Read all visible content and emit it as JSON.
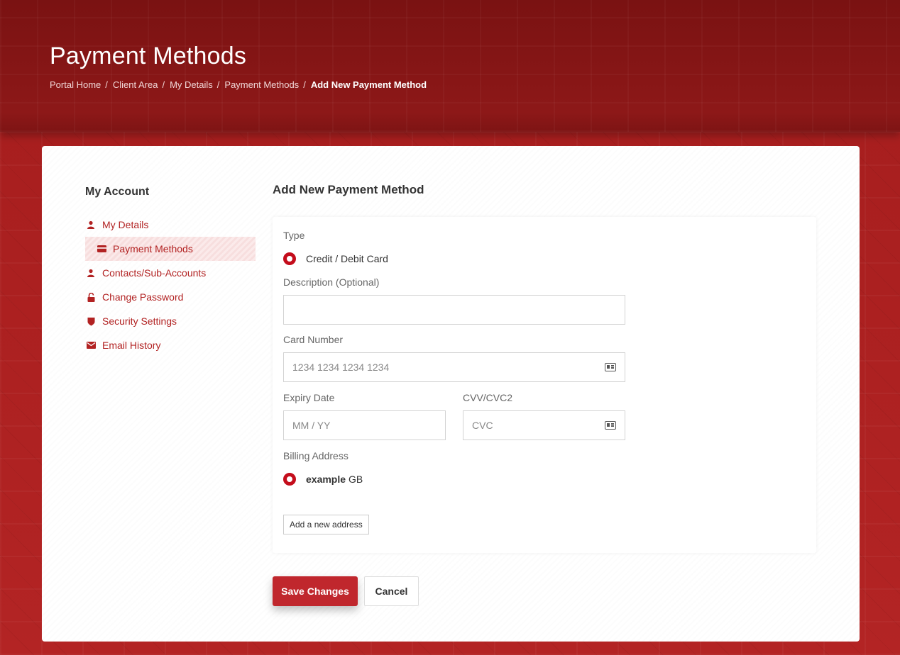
{
  "header": {
    "title": "Payment Methods",
    "breadcrumb": [
      "Portal Home",
      "Client Area",
      "My Details",
      "Payment Methods"
    ],
    "breadcrumb_active": "Add New Payment Method",
    "separator": "/"
  },
  "sidebar": {
    "title": "My Account",
    "items": [
      {
        "label": "My Details",
        "icon": "user-icon"
      },
      {
        "label": "Payment Methods",
        "icon": "credit-card-icon",
        "active": true
      },
      {
        "label": "Contacts/Sub-Accounts",
        "icon": "user-icon"
      },
      {
        "label": "Change Password",
        "icon": "lock-icon"
      },
      {
        "label": "Security Settings",
        "icon": "shield-icon"
      },
      {
        "label": "Email History",
        "icon": "envelope-icon"
      }
    ]
  },
  "form": {
    "title": "Add New Payment Method",
    "type_label": "Type",
    "type_option": "Credit / Debit Card",
    "description_label": "Description (Optional)",
    "description_value": "",
    "card_number_label": "Card Number",
    "card_number_placeholder": "1234 1234 1234 1234",
    "expiry_label": "Expiry Date",
    "expiry_placeholder": "MM / YY",
    "cvv_label": "CVV/CVC2",
    "cvv_placeholder": "CVC",
    "billing_label": "Billing Address",
    "billing_name": "example",
    "billing_country": "GB",
    "add_address_label": "Add a new address"
  },
  "actions": {
    "save_label": "Save Changes",
    "cancel_label": "Cancel"
  },
  "colors": {
    "accent": "#c0272d",
    "link": "#b22222",
    "header_bg": "#8d1818",
    "page_bg": "#b02323"
  }
}
